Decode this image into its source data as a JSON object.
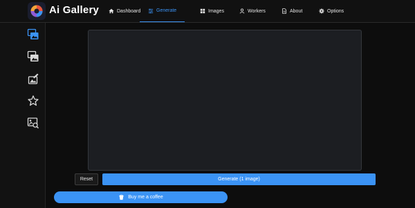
{
  "app": {
    "title": "Ai Gallery",
    "accent_color": "#3b93f5",
    "logo_icon": "ai-gallery-logo"
  },
  "nav": [
    {
      "id": "dashboard",
      "label": "Dashboard",
      "icon": "home-icon",
      "active": false
    },
    {
      "id": "generate",
      "label": "Generate",
      "icon": "sliders-icon",
      "active": true
    },
    {
      "id": "images",
      "label": "Images",
      "icon": "grid-icon",
      "active": false
    },
    {
      "id": "workers",
      "label": "Workers",
      "icon": "user-icon",
      "active": false
    },
    {
      "id": "about",
      "label": "About",
      "icon": "document-icon",
      "active": false
    },
    {
      "id": "options",
      "label": "Options",
      "icon": "gear-icon",
      "active": false
    }
  ],
  "sidebar": {
    "items": [
      {
        "icon": "text-to-image-icon",
        "active": true
      },
      {
        "icon": "image-to-image-icon",
        "active": false
      },
      {
        "icon": "inpainting-icon",
        "active": false
      },
      {
        "icon": "rate-star-icon",
        "active": false
      },
      {
        "icon": "image-search-icon",
        "active": false
      }
    ]
  },
  "actions": {
    "reset_label": "Reset",
    "generate_label": "Generate (1 image)",
    "coffee_label": "Buy me a coffee"
  }
}
